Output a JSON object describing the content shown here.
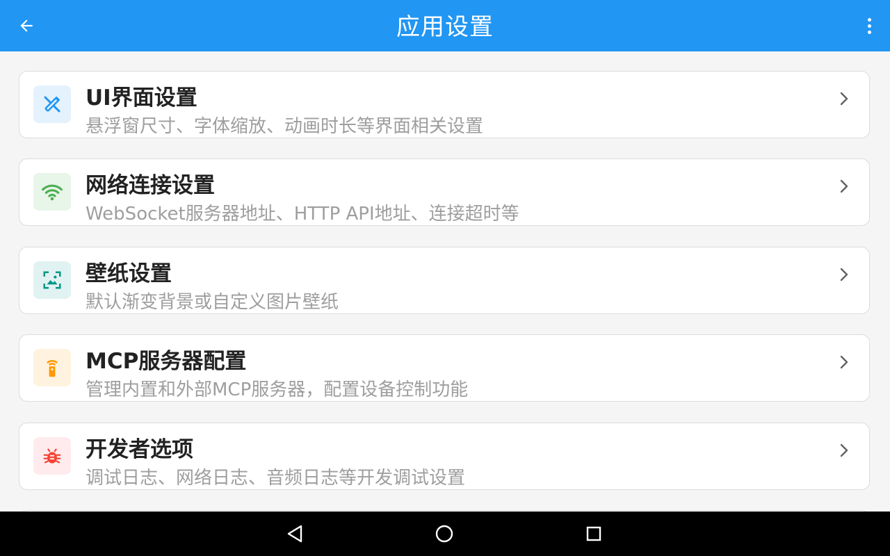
{
  "header": {
    "title": "应用设置",
    "back_icon": "arrow-back-icon",
    "menu_icon": "more-vert-icon",
    "background": "#2196f3"
  },
  "settings": [
    {
      "title": "UI界面设置",
      "subtitle": "悬浮窗尺寸、字体缩放、动画时长等界面相关设置",
      "icon": "design-tools-icon",
      "icon_color": "#2196f3",
      "icon_bg": "#e3f2fd"
    },
    {
      "title": "网络连接设置",
      "subtitle": "WebSocket服务器地址、HTTP API地址、连接超时等",
      "icon": "wifi-icon",
      "icon_color": "#4caf50",
      "icon_bg": "#e8f5e9"
    },
    {
      "title": "壁纸设置",
      "subtitle": "默认渐变背景或自定义图片壁纸",
      "icon": "wallpaper-icon",
      "icon_color": "#009688",
      "icon_bg": "#e0f2f1"
    },
    {
      "title": "MCP服务器配置",
      "subtitle": "管理内置和外部MCP服务器，配置设备控制功能",
      "icon": "settings-remote-icon",
      "icon_color": "#ff9800",
      "icon_bg": "#fff3e0"
    },
    {
      "title": "开发者选项",
      "subtitle": "调试日志、网络日志、音频日志等开发调试设置",
      "icon": "bug-icon",
      "icon_color": "#f44336",
      "icon_bg": "#ffebee"
    }
  ],
  "navbar": {
    "back": "nav-back-icon",
    "home": "nav-home-icon",
    "recents": "nav-recents-icon"
  }
}
